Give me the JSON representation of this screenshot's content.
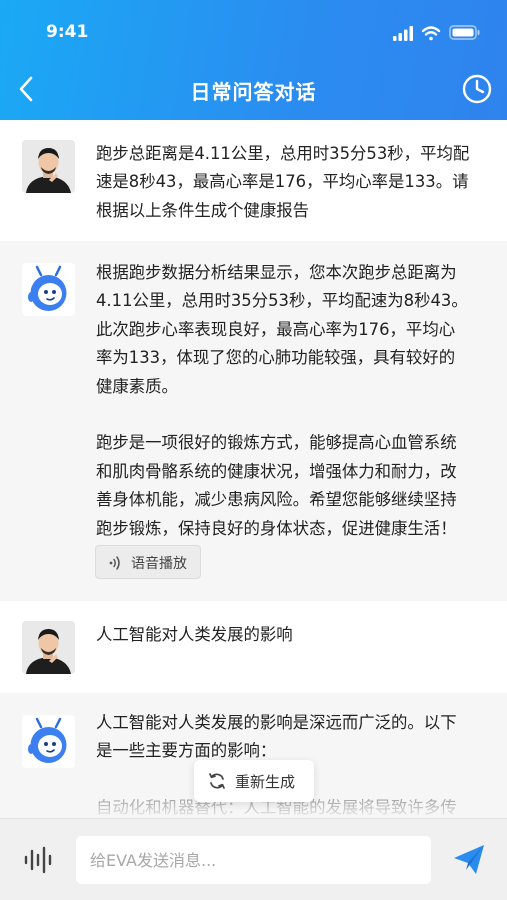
{
  "status_bar": {
    "time": "9:41"
  },
  "header": {
    "title": "日常问答对话"
  },
  "messages": [
    {
      "role": "user",
      "text": "跑步总距离是4.11公里，总用时35分53秒，平均配\n速是8秒43，最高心率是176，平均心率是133。请\n根据以上条件生成个健康报告"
    },
    {
      "role": "assistant",
      "text": "根据跑步数据分析结果显示，您本次跑步总距离为\n4.11公里，总用时35分53秒，平均配速为8秒43。\n此次跑步心率表现良好，最高心率为176，平均心\n率为133，体现了您的心肺功能较强，具有较好的\n健康素质。\n\n跑步是一项很好的锻炼方式，能够提高心血管系统\n和肌肉骨骼系统的健康状况，增强体力和耐力，改\n善身体机能，减少患病风险。希望您能够继续坚持\n跑步锻炼，保持良好的身体状态，促进健康生活！",
      "voice_label": "语音播放"
    },
    {
      "role": "user",
      "text": "人工智能对人类发展的影响"
    },
    {
      "role": "assistant",
      "text": "人工智能对人类发展的影响是深远而广泛的。以下\n是一些主要方面的影响：\n\n自动化和机器替代：人工智能的发展将导致许多传"
    }
  ],
  "regenerate_label": "重新生成",
  "input": {
    "placeholder": "给EVA发送消息..."
  },
  "colors": {
    "header_start": "#1aa9f5",
    "header_end": "#2f83ee",
    "send": "#2b8cf0"
  },
  "icons": [
    "back-icon",
    "clock-history-icon",
    "sound-wave-icon",
    "refresh-icon",
    "microphone-wave-icon",
    "send-plane-icon"
  ]
}
